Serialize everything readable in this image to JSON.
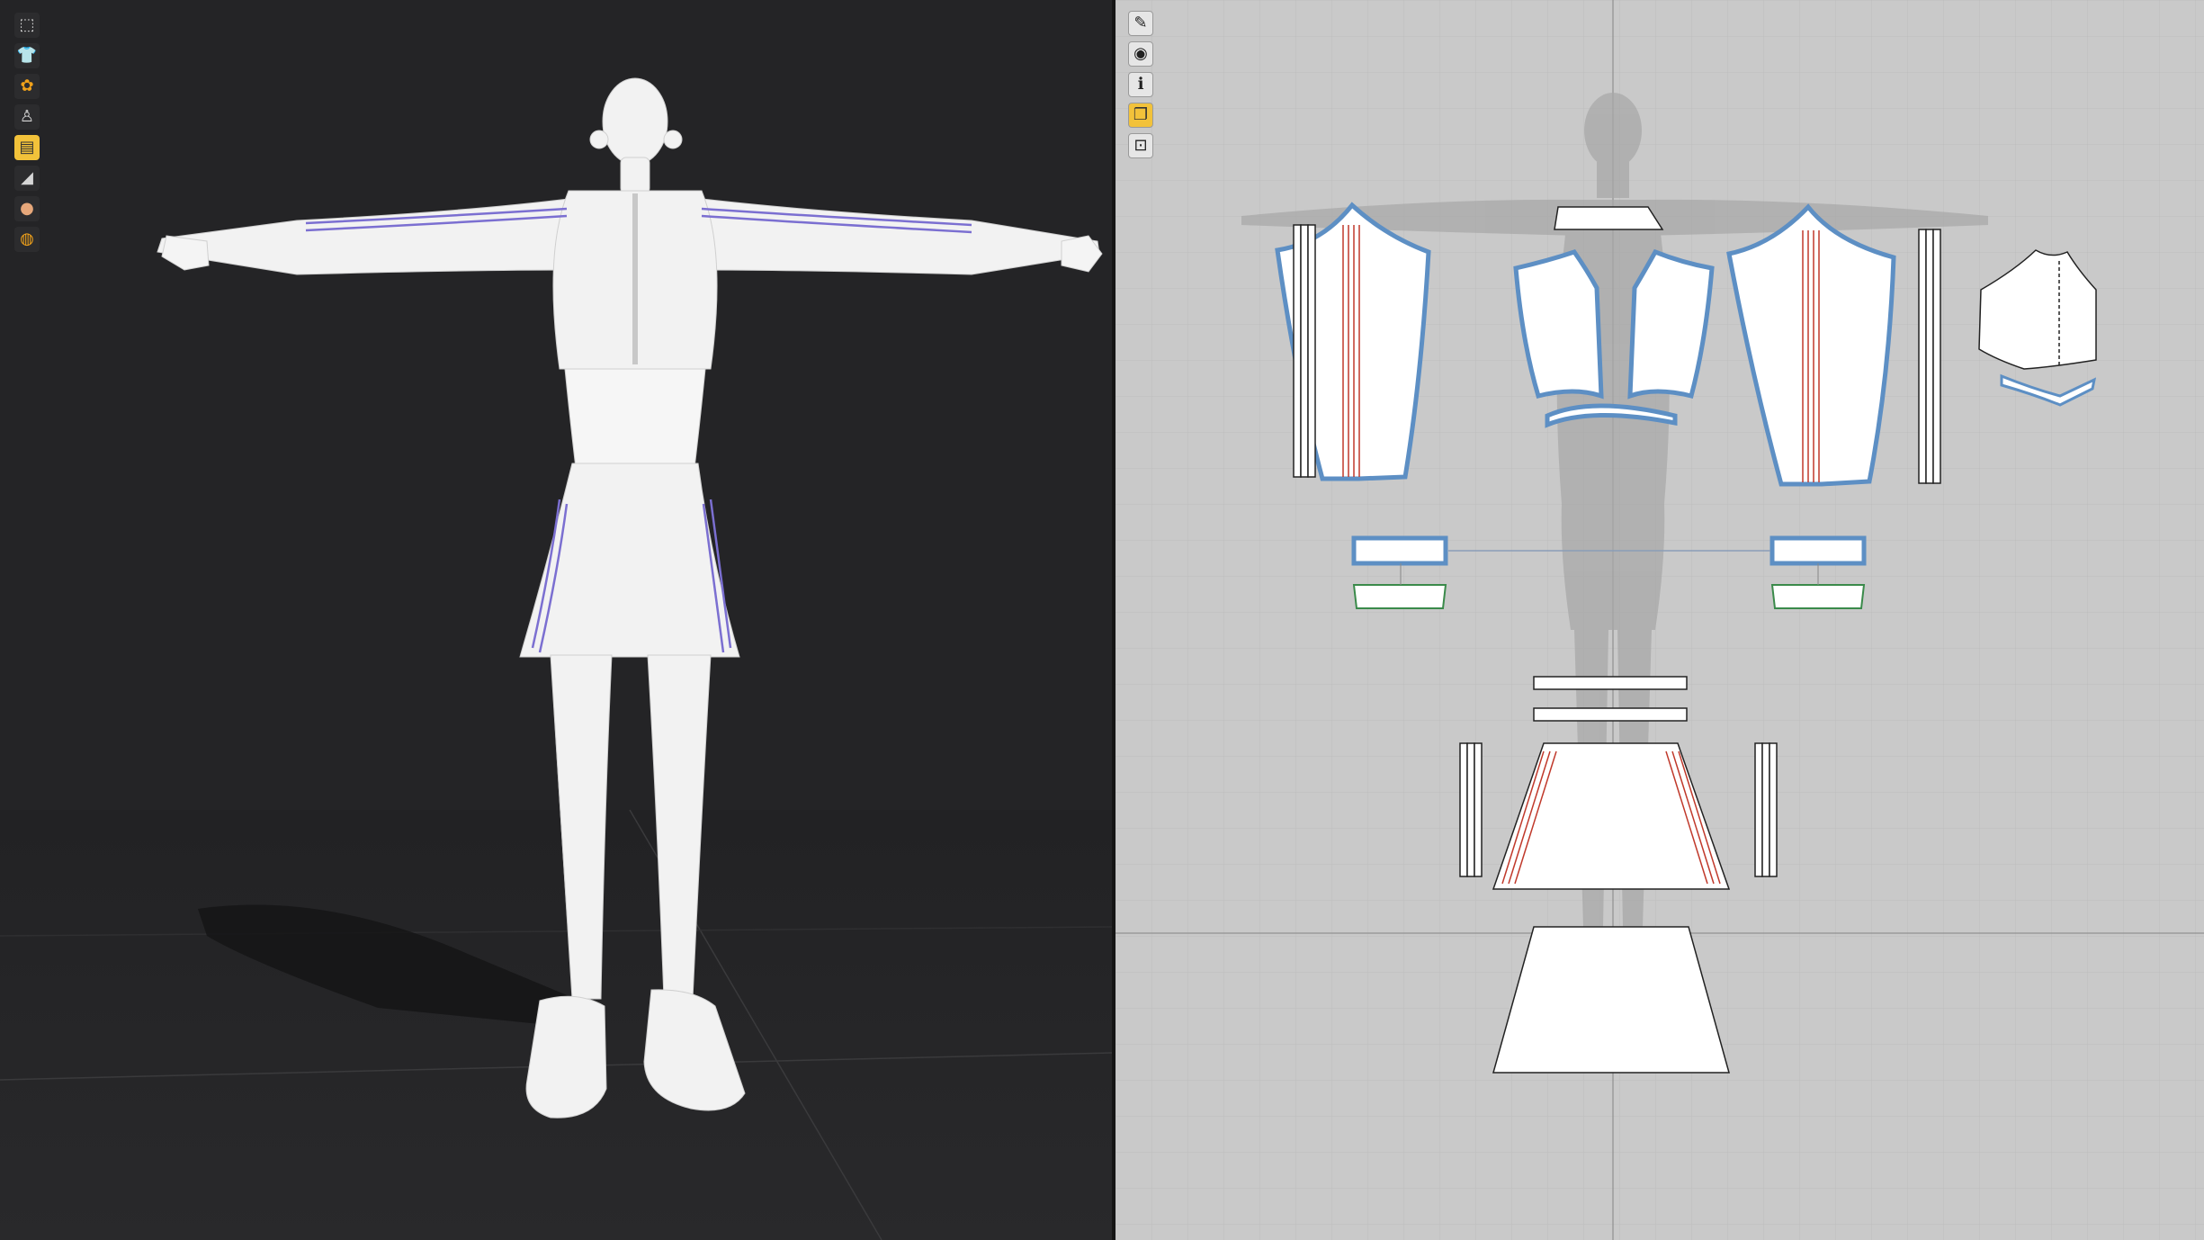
{
  "app": {
    "left_view": "3d-avatar-view",
    "right_view": "2d-pattern-view"
  },
  "toolbar_3d": [
    {
      "icon": "select-icon",
      "glyph": "⬚"
    },
    {
      "icon": "garment-icon",
      "glyph": "👕"
    },
    {
      "icon": "physics-icon",
      "glyph": "✿"
    },
    {
      "icon": "avatar-icon",
      "glyph": "♙"
    },
    {
      "icon": "fabric-icon",
      "glyph": "▤"
    },
    {
      "icon": "shoe-icon",
      "glyph": "◢"
    },
    {
      "icon": "skin-icon",
      "glyph": "●"
    },
    {
      "icon": "texture-icon",
      "glyph": "◍"
    }
  ],
  "toolbar_2d": [
    {
      "icon": "edit-pattern-icon",
      "glyph": "✎"
    },
    {
      "icon": "show-garment-icon",
      "glyph": "◉"
    },
    {
      "icon": "info-icon",
      "glyph": "ℹ"
    },
    {
      "icon": "fold-icon",
      "glyph": "❐"
    },
    {
      "icon": "lock-garment-icon",
      "glyph": "⊡"
    }
  ],
  "colors": {
    "viewport_3d": "#242426",
    "viewport_2d": "#c9c9c9",
    "grid_2d": "#bdbdbd",
    "pattern_fill": "#ffffff",
    "selected_outline": "#5d8fc4",
    "topstitch": "#c0392b",
    "seam_green": "#3a8a4a",
    "avatar_silhouette": "#a8a8a8",
    "stripe_purple": "#7b6fd1",
    "accent": "#f2c23a"
  }
}
